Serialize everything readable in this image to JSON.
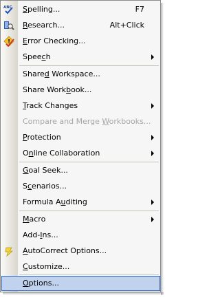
{
  "menu": {
    "items": [
      {
        "label": "Spelling...",
        "mnemonic_index": 0,
        "shortcut": "F7",
        "icon": "spelling-icon",
        "submenu": false,
        "disabled": false
      },
      {
        "label": "Research...",
        "mnemonic_index": 0,
        "shortcut": "Alt+Click",
        "icon": "research-icon",
        "submenu": false,
        "disabled": false
      },
      {
        "label": "Error Checking...",
        "mnemonic_index": 0,
        "shortcut": "",
        "icon": "error-checking-icon",
        "submenu": false,
        "disabled": false
      },
      {
        "label": "Speech",
        "mnemonic_index": 4,
        "shortcut": "",
        "icon": "",
        "submenu": true,
        "disabled": false
      },
      {
        "label": "Shared Workspace...",
        "mnemonic_index": 5,
        "shortcut": "",
        "icon": "",
        "submenu": false,
        "disabled": false
      },
      {
        "label": "Share Workbook...",
        "mnemonic_index": 10,
        "shortcut": "",
        "icon": "",
        "submenu": false,
        "disabled": false
      },
      {
        "label": "Track Changes",
        "mnemonic_index": 0,
        "shortcut": "",
        "icon": "",
        "submenu": true,
        "disabled": false
      },
      {
        "label": "Compare and Merge Workbooks...",
        "mnemonic_index": 18,
        "shortcut": "",
        "icon": "",
        "submenu": false,
        "disabled": true
      },
      {
        "label": "Protection",
        "mnemonic_index": 0,
        "shortcut": "",
        "icon": "",
        "submenu": true,
        "disabled": false
      },
      {
        "label": "Online Collaboration",
        "mnemonic_index": 1,
        "shortcut": "",
        "icon": "",
        "submenu": true,
        "disabled": false
      },
      {
        "label": "Goal Seek...",
        "mnemonic_index": 0,
        "shortcut": "",
        "icon": "",
        "submenu": false,
        "disabled": false
      },
      {
        "label": "Scenarios...",
        "mnemonic_index": 1,
        "shortcut": "",
        "icon": "",
        "submenu": false,
        "disabled": false
      },
      {
        "label": "Formula Auditing",
        "mnemonic_index": 9,
        "shortcut": "",
        "icon": "",
        "submenu": true,
        "disabled": false
      },
      {
        "label": "Macro",
        "mnemonic_index": 0,
        "shortcut": "",
        "icon": "",
        "submenu": true,
        "disabled": false
      },
      {
        "label": "Add-Ins...",
        "mnemonic_index": 4,
        "shortcut": "",
        "icon": "",
        "submenu": false,
        "disabled": false
      },
      {
        "label": "AutoCorrect Options...",
        "mnemonic_index": 0,
        "shortcut": "",
        "icon": "autocorrect-icon",
        "submenu": false,
        "disabled": false
      },
      {
        "label": "Customize...",
        "mnemonic_index": 0,
        "shortcut": "",
        "icon": "",
        "submenu": false,
        "disabled": false
      },
      {
        "label": "Options...",
        "mnemonic_index": 0,
        "shortcut": "",
        "icon": "",
        "submenu": false,
        "disabled": false,
        "highlighted": true
      }
    ]
  },
  "colors": {
    "highlight_bg": "#c1d2ee",
    "highlight_border": "#316ac5",
    "disabled_text": "#a6a6a6"
  }
}
